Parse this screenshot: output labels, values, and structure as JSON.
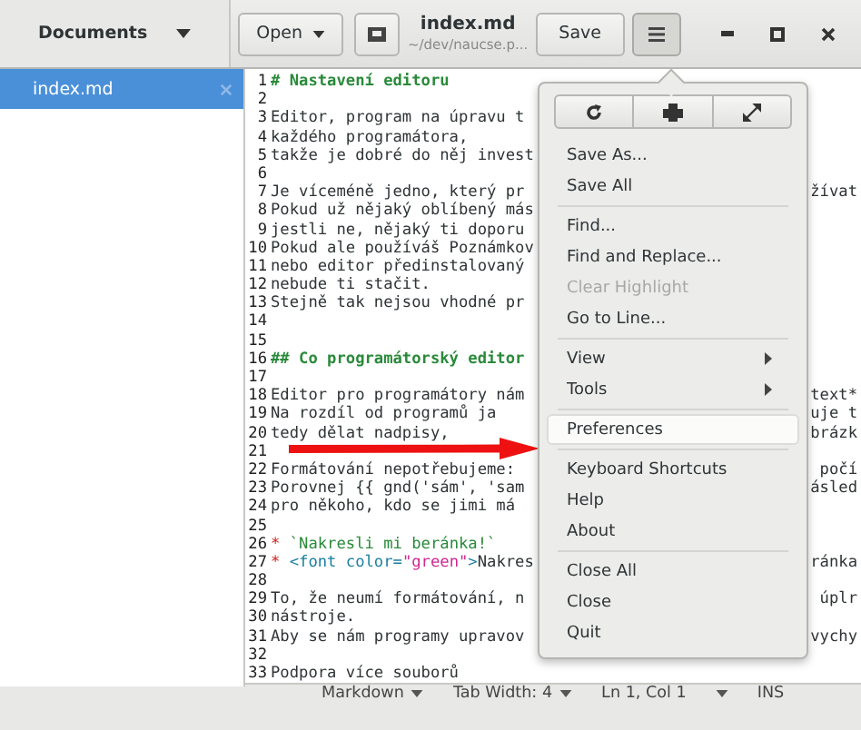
{
  "sidebar": {
    "title": "Documents",
    "items": [
      {
        "label": "index.md",
        "selected": true
      }
    ]
  },
  "header": {
    "open_label": "Open",
    "title": "index.md",
    "subtitle": "~/dev/naucse.p...",
    "save_label": "Save",
    "menu_pressed": true
  },
  "editor": {
    "lines": [
      {
        "num": "1",
        "segments": [
          {
            "kind": "heading",
            "text": "# Nastavení editoru"
          }
        ]
      },
      {
        "num": "2"
      },
      {
        "num": "3",
        "segments": [
          {
            "kind": "plain",
            "text": "Editor, program na úpravu t"
          }
        ]
      },
      {
        "num": "4",
        "segments": [
          {
            "kind": "plain",
            "text": "každého programátora,"
          }
        ]
      },
      {
        "num": "5",
        "segments": [
          {
            "kind": "plain",
            "text": "takže je dobré do něj invest"
          }
        ]
      },
      {
        "num": "6"
      },
      {
        "num": "7",
        "segments": [
          {
            "kind": "plain",
            "text": "Je víceméně jedno, který pr"
          }
        ],
        "right": "žívat"
      },
      {
        "num": "8",
        "segments": [
          {
            "kind": "plain",
            "text": "Pokud už nějaký oblíbený más"
          }
        ]
      },
      {
        "num": "9",
        "segments": [
          {
            "kind": "plain",
            "text": "jestli ne, nějaký ti doporu"
          }
        ]
      },
      {
        "num": "10",
        "segments": [
          {
            "kind": "plain",
            "text": "Pokud ale používáš Poznámkov"
          }
        ]
      },
      {
        "num": "11",
        "segments": [
          {
            "kind": "plain",
            "text": "nebo editor předinstalovaný"
          }
        ]
      },
      {
        "num": "12",
        "segments": [
          {
            "kind": "plain",
            "text": "nebude ti stačit."
          }
        ]
      },
      {
        "num": "13",
        "segments": [
          {
            "kind": "plain",
            "text": "Stejně tak nejsou vhodné pr"
          }
        ]
      },
      {
        "num": "14"
      },
      {
        "num": "15"
      },
      {
        "num": "16",
        "segments": [
          {
            "kind": "heading",
            "text": "## Co programátorský editor"
          }
        ]
      },
      {
        "num": "17"
      },
      {
        "num": "18",
        "segments": [
          {
            "kind": "plain",
            "text": "Editor pro programátory nám"
          }
        ],
        "right": "text*"
      },
      {
        "num": "19",
        "segments": [
          {
            "kind": "plain",
            "text": "Na rozdíl od programů ja"
          }
        ],
        "right": "uje t"
      },
      {
        "num": "20",
        "segments": [
          {
            "kind": "plain",
            "text": "tedy dělat nadpisy,"
          }
        ],
        "right": "brázk"
      },
      {
        "num": "21"
      },
      {
        "num": "22",
        "segments": [
          {
            "kind": "plain",
            "text": "Formátování nepotřebujeme:"
          }
        ],
        "right": "počí"
      },
      {
        "num": "23",
        "segments": [
          {
            "kind": "plain",
            "text": "Porovnej {{ gnd('sám', 'sam"
          }
        ],
        "right": "ásled"
      },
      {
        "num": "24",
        "segments": [
          {
            "kind": "plain",
            "text": "pro někoho, kdo se jimi má"
          }
        ]
      },
      {
        "num": "25"
      },
      {
        "num": "26",
        "segments": [
          {
            "kind": "bullet",
            "text": "*"
          },
          {
            "kind": "code",
            "text": " `Nakresli mi beránka!`"
          }
        ]
      },
      {
        "num": "27",
        "segments": [
          {
            "kind": "bullet",
            "text": "*"
          },
          {
            "kind": "tag",
            "text": " <font color="
          },
          {
            "kind": "string",
            "text": "\"green\""
          },
          {
            "kind": "tag",
            "text": ">"
          },
          {
            "kind": "plain",
            "text": "Nakres"
          }
        ],
        "right": "ránka"
      },
      {
        "num": "28"
      },
      {
        "num": "29",
        "segments": [
          {
            "kind": "plain",
            "text": "To, že neumí formátování, n"
          }
        ],
        "right": "úplr"
      },
      {
        "num": "30",
        "segments": [
          {
            "kind": "plain",
            "text": "nástroje."
          }
        ]
      },
      {
        "num": "31",
        "segments": [
          {
            "kind": "plain",
            "text": "Aby se nám programy upravov"
          }
        ],
        "right": "vychy"
      },
      {
        "num": "32"
      },
      {
        "num": "33",
        "segments": [
          {
            "kind": "plain",
            "text": "Podpora více souborů"
          }
        ]
      }
    ]
  },
  "menu": {
    "sections": [
      [
        {
          "label": "Save As...",
          "kind": "item",
          "disabled": false,
          "selected": false
        },
        {
          "label": "Save All",
          "kind": "item",
          "disabled": false,
          "selected": false
        }
      ],
      [
        {
          "label": "Find...",
          "kind": "item",
          "disabled": false,
          "selected": false
        },
        {
          "label": "Find and Replace...",
          "kind": "item",
          "disabled": false,
          "selected": false
        },
        {
          "label": "Clear Highlight",
          "kind": "item",
          "disabled": true,
          "selected": false
        },
        {
          "label": "Go to Line...",
          "kind": "item",
          "disabled": false,
          "selected": false
        }
      ],
      [
        {
          "label": "View",
          "kind": "submenu",
          "disabled": false,
          "selected": false
        },
        {
          "label": "Tools",
          "kind": "submenu",
          "disabled": false,
          "selected": false
        }
      ],
      [
        {
          "label": "Preferences",
          "kind": "item",
          "disabled": false,
          "selected": true
        }
      ],
      [
        {
          "label": "Keyboard Shortcuts",
          "kind": "item",
          "disabled": false,
          "selected": false
        },
        {
          "label": "Help",
          "kind": "item",
          "disabled": false,
          "selected": false
        },
        {
          "label": "About",
          "kind": "item",
          "disabled": false,
          "selected": false
        }
      ],
      [
        {
          "label": "Close All",
          "kind": "item",
          "disabled": false,
          "selected": false
        },
        {
          "label": "Close",
          "kind": "item",
          "disabled": false,
          "selected": false
        },
        {
          "label": "Quit",
          "kind": "item",
          "disabled": false,
          "selected": false
        }
      ]
    ]
  },
  "status_bar": {
    "language": "Markdown",
    "tab_width": "Tab Width: 4",
    "position": "Ln 1, Col 1",
    "mode": "INS"
  }
}
